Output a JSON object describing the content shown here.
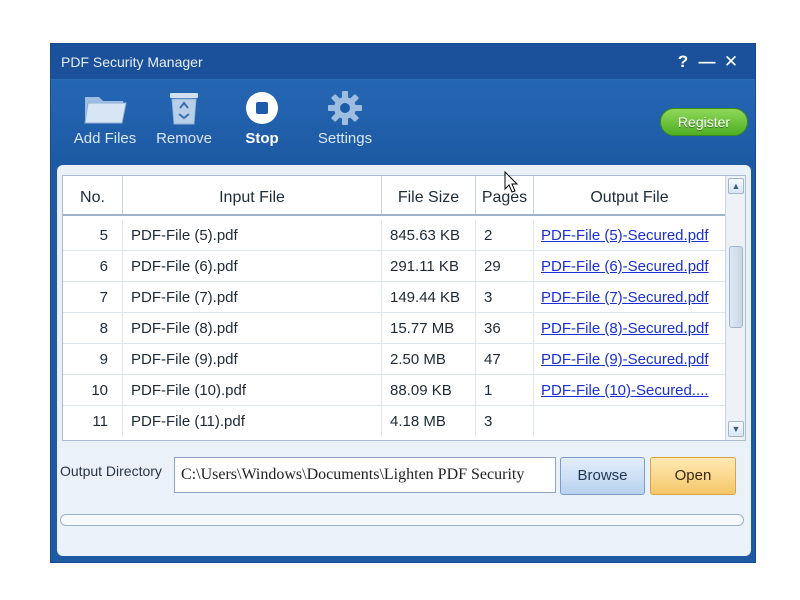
{
  "window": {
    "title": "PDF Security Manager",
    "help": "?",
    "minimize": "—",
    "close": "✕"
  },
  "toolbar": {
    "add_files": "Add Files",
    "remove": "Remove",
    "stop": "Stop",
    "settings": "Settings",
    "register": "Register"
  },
  "table": {
    "headers": [
      "No.",
      "Input File",
      "File Size",
      "Pages",
      "Output File"
    ],
    "rows": [
      {
        "no": "5",
        "input": "PDF-File (5).pdf",
        "size": "845.63 KB",
        "pages": "2",
        "output": "PDF-File (5)-Secured.pdf"
      },
      {
        "no": "6",
        "input": "PDF-File (6).pdf",
        "size": "291.11 KB",
        "pages": "29",
        "output": "PDF-File (6)-Secured.pdf"
      },
      {
        "no": "7",
        "input": "PDF-File (7).pdf",
        "size": "149.44 KB",
        "pages": "3",
        "output": "PDF-File (7)-Secured.pdf"
      },
      {
        "no": "8",
        "input": "PDF-File (8).pdf",
        "size": "15.77 MB",
        "pages": "36",
        "output": "PDF-File (8)-Secured.pdf"
      },
      {
        "no": "9",
        "input": "PDF-File (9).pdf",
        "size": "2.50 MB",
        "pages": "47",
        "output": "PDF-File (9)-Secured.pdf"
      },
      {
        "no": "10",
        "input": "PDF-File (10).pdf",
        "size": "88.09 KB",
        "pages": "1",
        "output": "PDF-File (10)-Secured...."
      },
      {
        "no": "11",
        "input": "PDF-File (11).pdf",
        "size": "4.18 MB",
        "pages": "3",
        "output": ""
      }
    ]
  },
  "output": {
    "label": "Output Directory",
    "path": "C:\\Users\\Windows\\Documents\\Lighten PDF Security",
    "browse": "Browse",
    "open": "Open"
  },
  "progress": {
    "value": 0
  },
  "colors": {
    "window_bg": "#1e5aa3",
    "register_green": "#4fae24",
    "link_blue": "#1a2fd6",
    "open_orange": "#f5c769"
  }
}
